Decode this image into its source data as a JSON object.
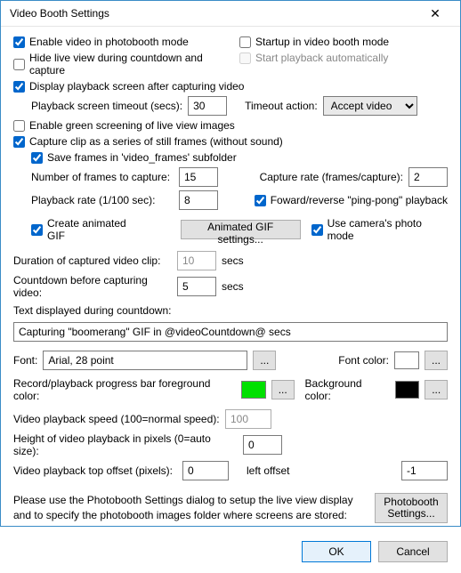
{
  "title": "Video Booth Settings",
  "closeGlyph": "✕",
  "checkboxes": {
    "enable_video": {
      "label": "Enable video in photobooth mode",
      "checked": true
    },
    "startup_mode": {
      "label": "Startup in video booth mode",
      "checked": false
    },
    "hide_live": {
      "label": "Hide live view during countdown and capture",
      "checked": false
    },
    "start_auto": {
      "label": "Start playback automatically",
      "checked": false,
      "disabled": true
    },
    "display_playback": {
      "label": "Display playback screen after capturing video",
      "checked": true
    },
    "green_screen": {
      "label": "Enable green screening of live view images",
      "checked": false
    },
    "capture_series": {
      "label": "Capture clip as a series of still frames (without sound)",
      "checked": true
    },
    "save_frames": {
      "label": "Save frames in 'video_frames' subfolder",
      "checked": true
    },
    "pingpong": {
      "label": "Foward/reverse \"ping-pong\" playback",
      "checked": true
    },
    "create_gif": {
      "label": "Create animated GIF",
      "checked": true
    },
    "use_camera_photo": {
      "label": "Use camera's photo mode",
      "checked": true
    }
  },
  "labels": {
    "playback_timeout": "Playback screen timeout (secs):",
    "timeout_action": "Timeout action:",
    "num_frames": "Number of frames to capture:",
    "capture_rate": "Capture rate (frames/capture):",
    "playback_rate": "Playback rate (1/100 sec):",
    "animated_gif_btn": "Animated GIF settings...",
    "duration": "Duration of captured video clip:",
    "secs": "secs",
    "countdown": "Countdown before capturing video:",
    "text_countdown": "Text displayed during countdown:",
    "font": "Font:",
    "font_color": "Font color:",
    "progress_fg": "Record/playback progress bar foreground color:",
    "bg_color": "Background color:",
    "playback_speed": "Video playback speed (100=normal speed):",
    "playback_height": "Height of video playback in pixels (0=auto size):",
    "top_offset": "Video playback top offset (pixels):",
    "left_offset": "left offset",
    "note": "Please use the Photobooth Settings dialog to setup the live view display and to specify the photobooth images folder where screens are stored:",
    "photobooth_btn_l1": "Photobooth",
    "photobooth_btn_l2": "Settings...",
    "browse": "...",
    "ok": "OK",
    "cancel": "Cancel"
  },
  "values": {
    "playback_timeout": "30",
    "timeout_action": "Accept video",
    "num_frames": "15",
    "capture_rate": "2",
    "playback_rate": "8",
    "duration": "10",
    "countdown": "5",
    "countdown_text": "Capturing \"boomerang\" GIF in @videoCountdown@ secs",
    "font_display": "Arial, 28 point",
    "playback_speed": "100",
    "playback_height": "0",
    "top_offset": "0",
    "left_offset": "-1"
  },
  "colors": {
    "progress_fg": "#00e000",
    "font_color": "#ffffff",
    "bg_color": "#000000"
  }
}
